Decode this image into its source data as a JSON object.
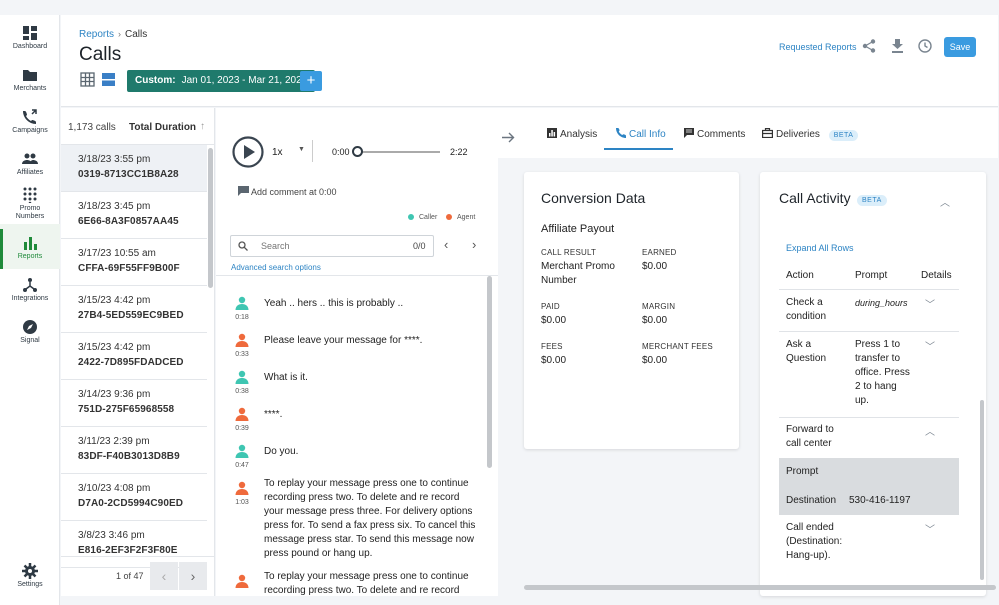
{
  "nav": [
    {
      "id": "dashboard",
      "label": "Dashboard"
    },
    {
      "id": "merchants",
      "label": "Merchants"
    },
    {
      "id": "campaigns",
      "label": "Campaigns"
    },
    {
      "id": "affiliates",
      "label": "Affiliates"
    },
    {
      "id": "promo",
      "label": "Promo\nNumbers"
    },
    {
      "id": "reports",
      "label": "Reports"
    },
    {
      "id": "integrations",
      "label": "Integrations"
    },
    {
      "id": "signal",
      "label": "Signal"
    },
    {
      "id": "settings",
      "label": "Settings"
    }
  ],
  "header": {
    "breadcrumb_root": "Reports",
    "breadcrumb_sep": "›",
    "breadcrumb_current": "Calls",
    "title": "Calls",
    "date_prefix": "Custom:",
    "date_range": "Jan 01, 2023 - Mar 21, 2023",
    "plus": "+",
    "requested_reports": "Requested Reports",
    "save": "Save"
  },
  "list": {
    "count": "1,173 calls",
    "sort_label": "Total Duration",
    "sort_arrow": "↑",
    "rows": [
      {
        "date": "3/18/23 3:55 pm",
        "id": "0319-8713CC1B8A28"
      },
      {
        "date": "3/18/23 3:45 pm",
        "id": "6E66-8A3F0857AA45"
      },
      {
        "date": "3/17/23 10:55 am",
        "id": "CFFA-69F55FF9B00F"
      },
      {
        "date": "3/15/23 4:42 pm",
        "id": "27B4-5ED559EC9BED"
      },
      {
        "date": "3/15/23 4:42 pm",
        "id": "2422-7D895FDADCED"
      },
      {
        "date": "3/14/23 9:36 pm",
        "id": "751D-275F65968558"
      },
      {
        "date": "3/11/23 2:39 pm",
        "id": "83DF-F40B3013D8B9"
      },
      {
        "date": "3/10/23 4:08 pm",
        "id": "D7A0-2CD5994C90ED"
      },
      {
        "date": "3/8/23 3:46 pm",
        "id": "E816-2EF3F2F3F80E"
      }
    ],
    "page": "1 of 47"
  },
  "player": {
    "speed": "1x",
    "current": "0:00",
    "total": "2:22",
    "progress": 0.0,
    "add_comment": "Add comment at 0:00",
    "legend_caller": "Caller",
    "legend_agent": "Agent",
    "search_placeholder": "Search",
    "search_count": "0/0",
    "advanced": "Advanced search options"
  },
  "messages": [
    {
      "who": "caller",
      "time": "0:18",
      "text": "Yeah .. hers .. this is probably .."
    },
    {
      "who": "agent",
      "time": "0:33",
      "text": "Please leave your message for ****."
    },
    {
      "who": "caller",
      "time": "0:38",
      "text": "What is it."
    },
    {
      "who": "agent",
      "time": "0:39",
      "text": "****."
    },
    {
      "who": "caller",
      "time": "0:47",
      "text": "Do you."
    },
    {
      "who": "agent",
      "time": "1:03",
      "text": "To replay your message press one to continue recording press two. To delete and re record your message press three. For delivery options press for. To send a fax press six. To cancel this message press star. To send this message now press pound or hang up."
    },
    {
      "who": "agent",
      "time": "",
      "text": "To replay your message press one to continue recording press two. To delete and re record"
    }
  ],
  "tabs": [
    {
      "label": "Analysis",
      "active": false
    },
    {
      "label": "Call Info",
      "active": true
    },
    {
      "label": "Comments",
      "active": false
    },
    {
      "label": "Deliveries",
      "active": false,
      "badge": "BETA"
    }
  ],
  "conversion": {
    "title": "Conversion Data",
    "subtitle": "Affiliate Payout",
    "call_result_label": "CALL RESULT",
    "call_result_value": "Merchant Promo Number",
    "earned_label": "EARNED",
    "earned_value": "$0.00",
    "paid_label": "PAID",
    "paid_value": "$0.00",
    "margin_label": "MARGIN",
    "margin_value": "$0.00",
    "fees_label": "FEES",
    "fees_value": "$0.00",
    "merchant_fees_label": "MERCHANT FEES",
    "merchant_fees_value": "$0.00"
  },
  "activity": {
    "title": "Call Activity",
    "badge": "BETA",
    "expand": "Expand All Rows",
    "col_action": "Action",
    "col_prompt": "Prompt",
    "col_details": "Details",
    "rows": [
      {
        "action": "Check a condition",
        "prompt": "during_hours"
      },
      {
        "action": "Ask a Question",
        "prompt": "Press 1 to transfer to office. Press 2 to hang up."
      },
      {
        "action": "Forward to call center",
        "prompt": ""
      },
      {
        "action": "Call ended (Destination: Hang-up).",
        "prompt": ""
      }
    ],
    "detail_prompt_label": "Prompt",
    "detail_destination_label": "Destination",
    "detail_destination_value": "530-416-1197"
  },
  "colors": {
    "caller": "#3fc6b2",
    "agent": "#ef6a3c",
    "accent": "#2d84c4",
    "date_button": "#1f7a6c",
    "active_nav": "#1f8a3a"
  }
}
